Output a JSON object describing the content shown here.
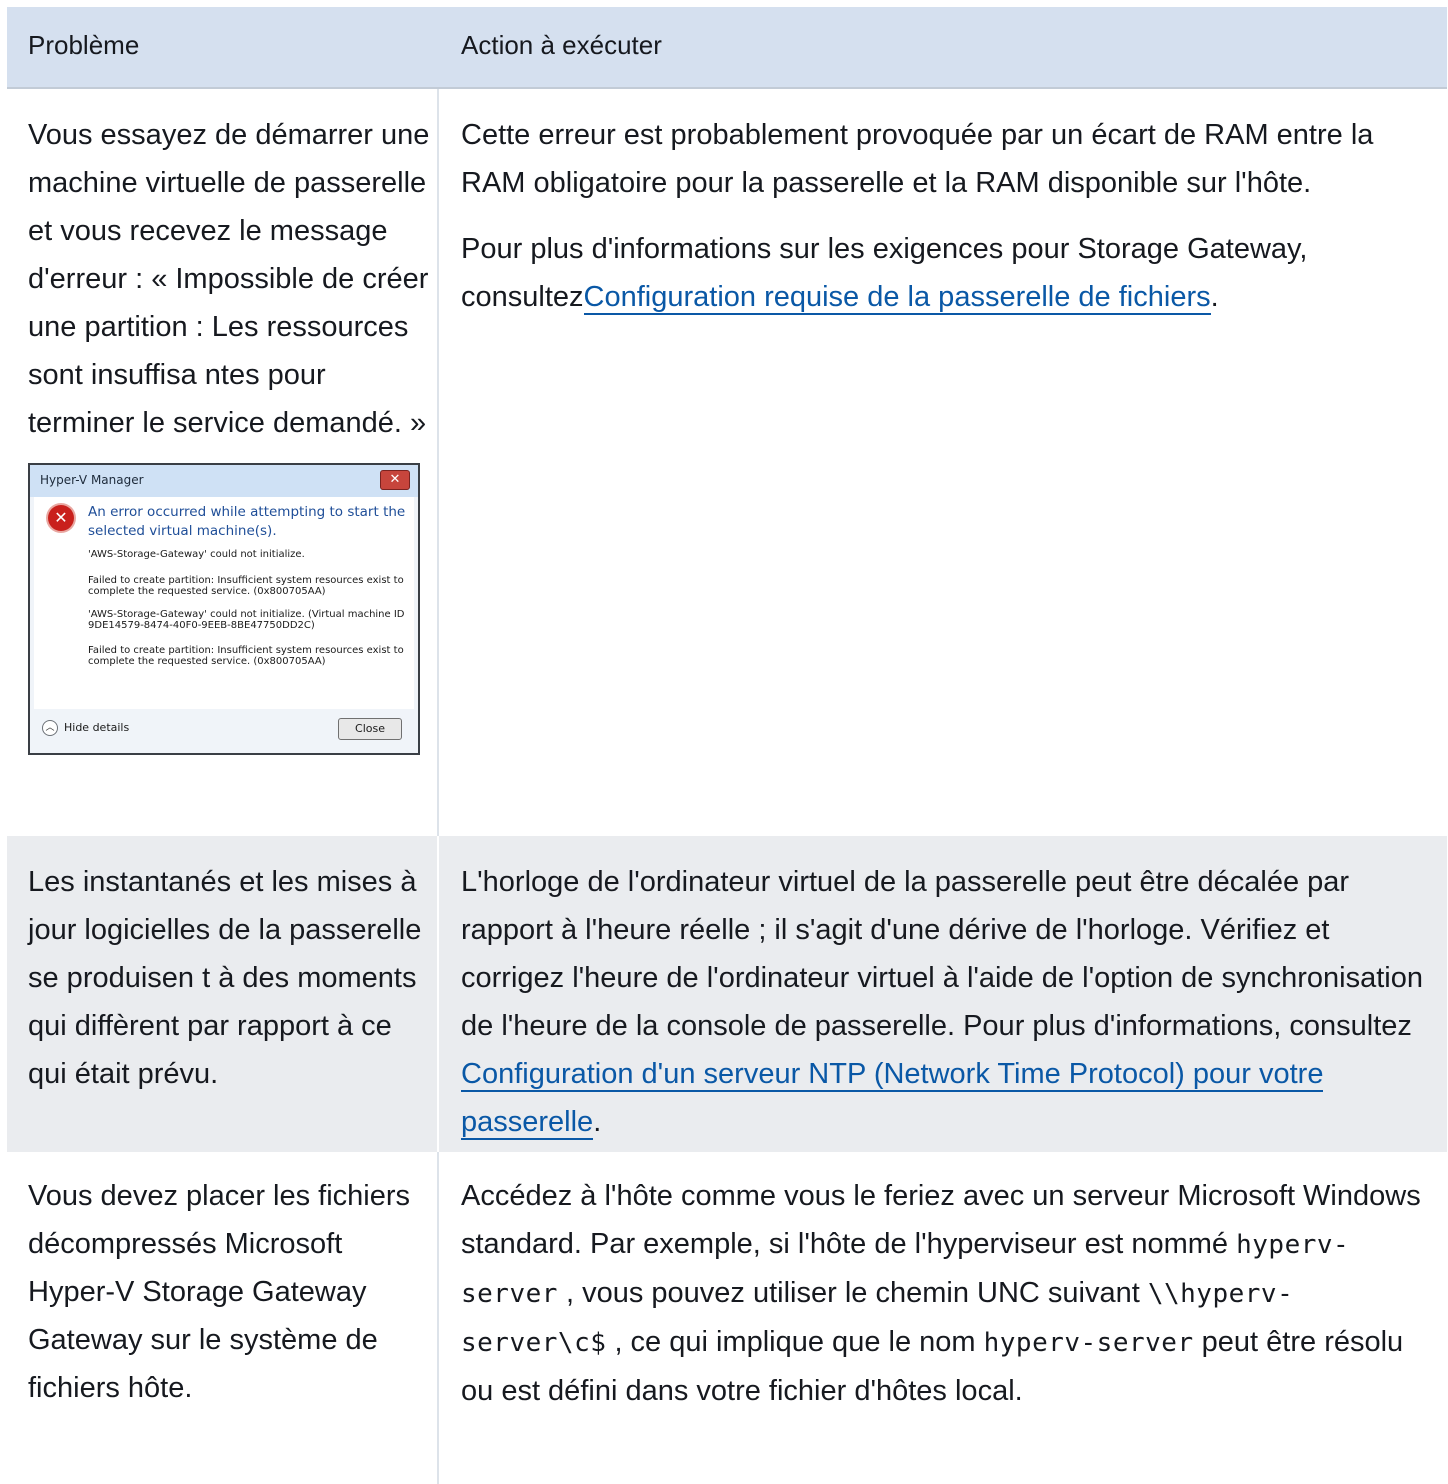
{
  "header": {
    "col1": "Problème",
    "col2": "Action à exécuter"
  },
  "rows": [
    {
      "problem": "Vous essayez de démarrer une machine virtuelle de passerelle et vous recevez le message d'erreur : « Impossible de créer une partition : Les ressources sont insuffisa ntes pour terminer le service demandé. »",
      "action_p1": "Cette erreur est probablement provoquée par un écart de RAM entre la RAM obligatoire pour la passerelle et la RAM disponible sur l'hôte.",
      "action_p2_prefix": "Pour plus d'informations sur les exigences pour Storage Gateway, consultez",
      "action_p2_link": "Configuration requise de la passerelle de fichiers",
      "action_p2_suffix": ".",
      "dialog": {
        "title": "Hyper-V Manager",
        "close_glyph": "✕",
        "heading": "An error occurred while attempting to start the selected virtual machine(s).",
        "lines": [
          "'AWS-Storage-Gateway' could not initialize.",
          "Failed to create partition: Insufficient system resources exist to",
          "complete the requested service. (0x800705AA)",
          "'AWS-Storage-Gateway' could not initialize. (Virtual machine ID",
          "9DE14579-8474-40F0-9EEB-8BE47750DD2C)",
          "Failed to create partition: Insufficient system resources exist to",
          "complete the requested service. (0x800705AA)"
        ],
        "hide_details": "Hide details",
        "close": "Close"
      }
    },
    {
      "problem": "Les instantanés et les mises à jour logicielles de la passerelle se produisen t à des moments qui diffèrent par rapport à ce qui était prévu.",
      "action_prefix": "L'horloge de l'ordinateur virtuel de la passerelle peut être décalée par rapport à l'heure réelle ; il s'agit d'une dérive de l'horloge. Vérifiez et corrigez l'heure de l'ordinateur virtuel à l'aide de l'option de synchronisation de l'heure de la console de passerelle. Pour plus d'informations, consultez ",
      "action_link": "Configuration d'un serveur NTP (Network Time Protocol) pour votre passerelle",
      "action_suffix": "."
    },
    {
      "problem": "Vous devez placer les fichiers décompressés Microsoft Hyper-V Storage Gateway Gateway sur le système de fichiers hôte.",
      "action_t1": "Accédez à l'hôte comme vous le feriez avec un serveur Microsoft Windows standard. Par exemple, si l'hôte de l'hyperviseur est nommé ",
      "action_code1": "hyperv-server",
      "action_t2": " , vous pouvez utiliser le chemin UNC suivant ",
      "action_code2": "\\\\hyperv-server\\c$",
      "action_t3": "  , ce qui implique que le nom ",
      "action_code3": "hyperv-server",
      "action_t4": "  peut être résolu ou est défini dans votre fichier d'hôtes local."
    }
  ]
}
